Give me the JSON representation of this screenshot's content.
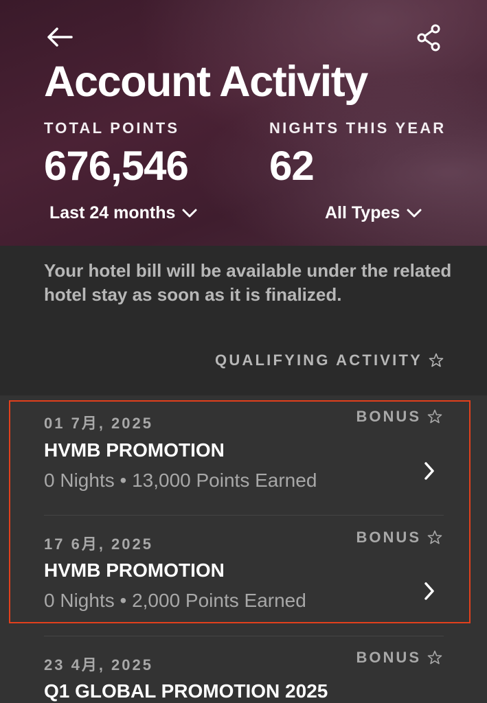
{
  "header": {
    "title": "Account Activity",
    "total_points_label": "TOTAL POINTS",
    "total_points_value": "676,546",
    "nights_label": "NIGHTS THIS YEAR",
    "nights_value": "62",
    "period_filter": "Last 24 months",
    "type_filter": "All Types",
    "back_icon": "arrow-left-icon",
    "share_icon": "share-icon"
  },
  "info": {
    "text": "Your hotel bill will be available under the related hotel stay as soon as it is finalized.",
    "qualifying_label": "QUALIFYING ACTIVITY"
  },
  "activities": [
    {
      "date": "01 7月, 2025",
      "badge": "BONUS",
      "title": "HVMB PROMOTION",
      "summary": "0 Nights • 13,000 Points Earned"
    },
    {
      "date": "17 6月, 2025",
      "badge": "BONUS",
      "title": "HVMB PROMOTION",
      "summary": "0 Nights • 2,000 Points Earned"
    },
    {
      "date": "23 4月, 2025",
      "badge": "BONUS",
      "title": "Q1 GLOBAL PROMOTION 2025",
      "summary": ""
    }
  ],
  "colors": {
    "highlight_border": "#e2401c",
    "list_background": "#333333",
    "header_tint": "#4b2235"
  }
}
